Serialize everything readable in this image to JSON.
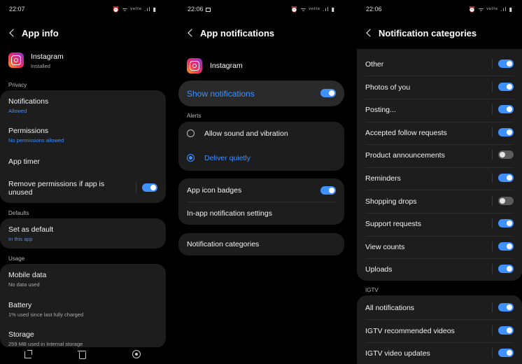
{
  "screen1": {
    "status_time": "22:07",
    "status_icons": "⏰ ᯤ ᵛᵒˡᵗᵉ .ıl ▮",
    "title": "App info",
    "app": {
      "name": "Instagram",
      "state": "Installed"
    },
    "privacy_label": "Privacy",
    "privacy_items": [
      {
        "label": "Notifications",
        "sub": "Allowed"
      },
      {
        "label": "Permissions",
        "sub": "No permissions allowed"
      },
      {
        "label": "App timer"
      },
      {
        "label": "Remove permissions if app is unused"
      }
    ],
    "defaults_label": "Defaults",
    "default_item": {
      "label": "Set as default",
      "sub": "In this app"
    },
    "usage_label": "Usage",
    "usage_items": [
      {
        "label": "Mobile data",
        "sub": "No data used"
      },
      {
        "label": "Battery",
        "sub": "1% used since last fully charged"
      },
      {
        "label": "Storage",
        "sub": "259 MB used in Internal storage"
      }
    ]
  },
  "screen2": {
    "status_time": "22:06",
    "status_icons": "⏰ ᯤ ᵛᵒˡᵗᵉ .ıl ▮",
    "title": "App notifications",
    "app_name": "Instagram",
    "show_notifications": "Show notifications",
    "alerts_label": "Alerts",
    "alert_options": [
      {
        "label": "Allow sound and vibration",
        "selected": false
      },
      {
        "label": "Deliver quietly",
        "selected": true
      }
    ],
    "app_icon_badges": "App icon badges",
    "in_app_settings": "In-app notification settings",
    "notification_categories": "Notification categories"
  },
  "screen3": {
    "status_time": "22:06",
    "status_icons": "⏰ ᯤ ᵛᵒˡᵗᵉ .ıl ▮",
    "title": "Notification categories",
    "categories": [
      {
        "label": "Other",
        "on": true
      },
      {
        "label": "Photos of you",
        "on": true
      },
      {
        "label": "Posting...",
        "on": true
      },
      {
        "label": "Accepted follow requests",
        "on": true
      },
      {
        "label": "Product announcements",
        "on": false
      },
      {
        "label": "Reminders",
        "on": true
      },
      {
        "label": "Shopping drops",
        "on": false
      },
      {
        "label": "Support requests",
        "on": true
      },
      {
        "label": "View counts",
        "on": true
      },
      {
        "label": "Uploads",
        "on": true
      }
    ],
    "igtv_label": "IGTV",
    "igtv_items": [
      {
        "label": "All notifications",
        "on": true
      },
      {
        "label": "IGTV recommended videos",
        "on": true
      },
      {
        "label": "IGTV video updates",
        "on": true
      }
    ]
  },
  "colors": {
    "accent": "#3e91ff",
    "card": "#1d1d1d",
    "background": "#000000"
  }
}
